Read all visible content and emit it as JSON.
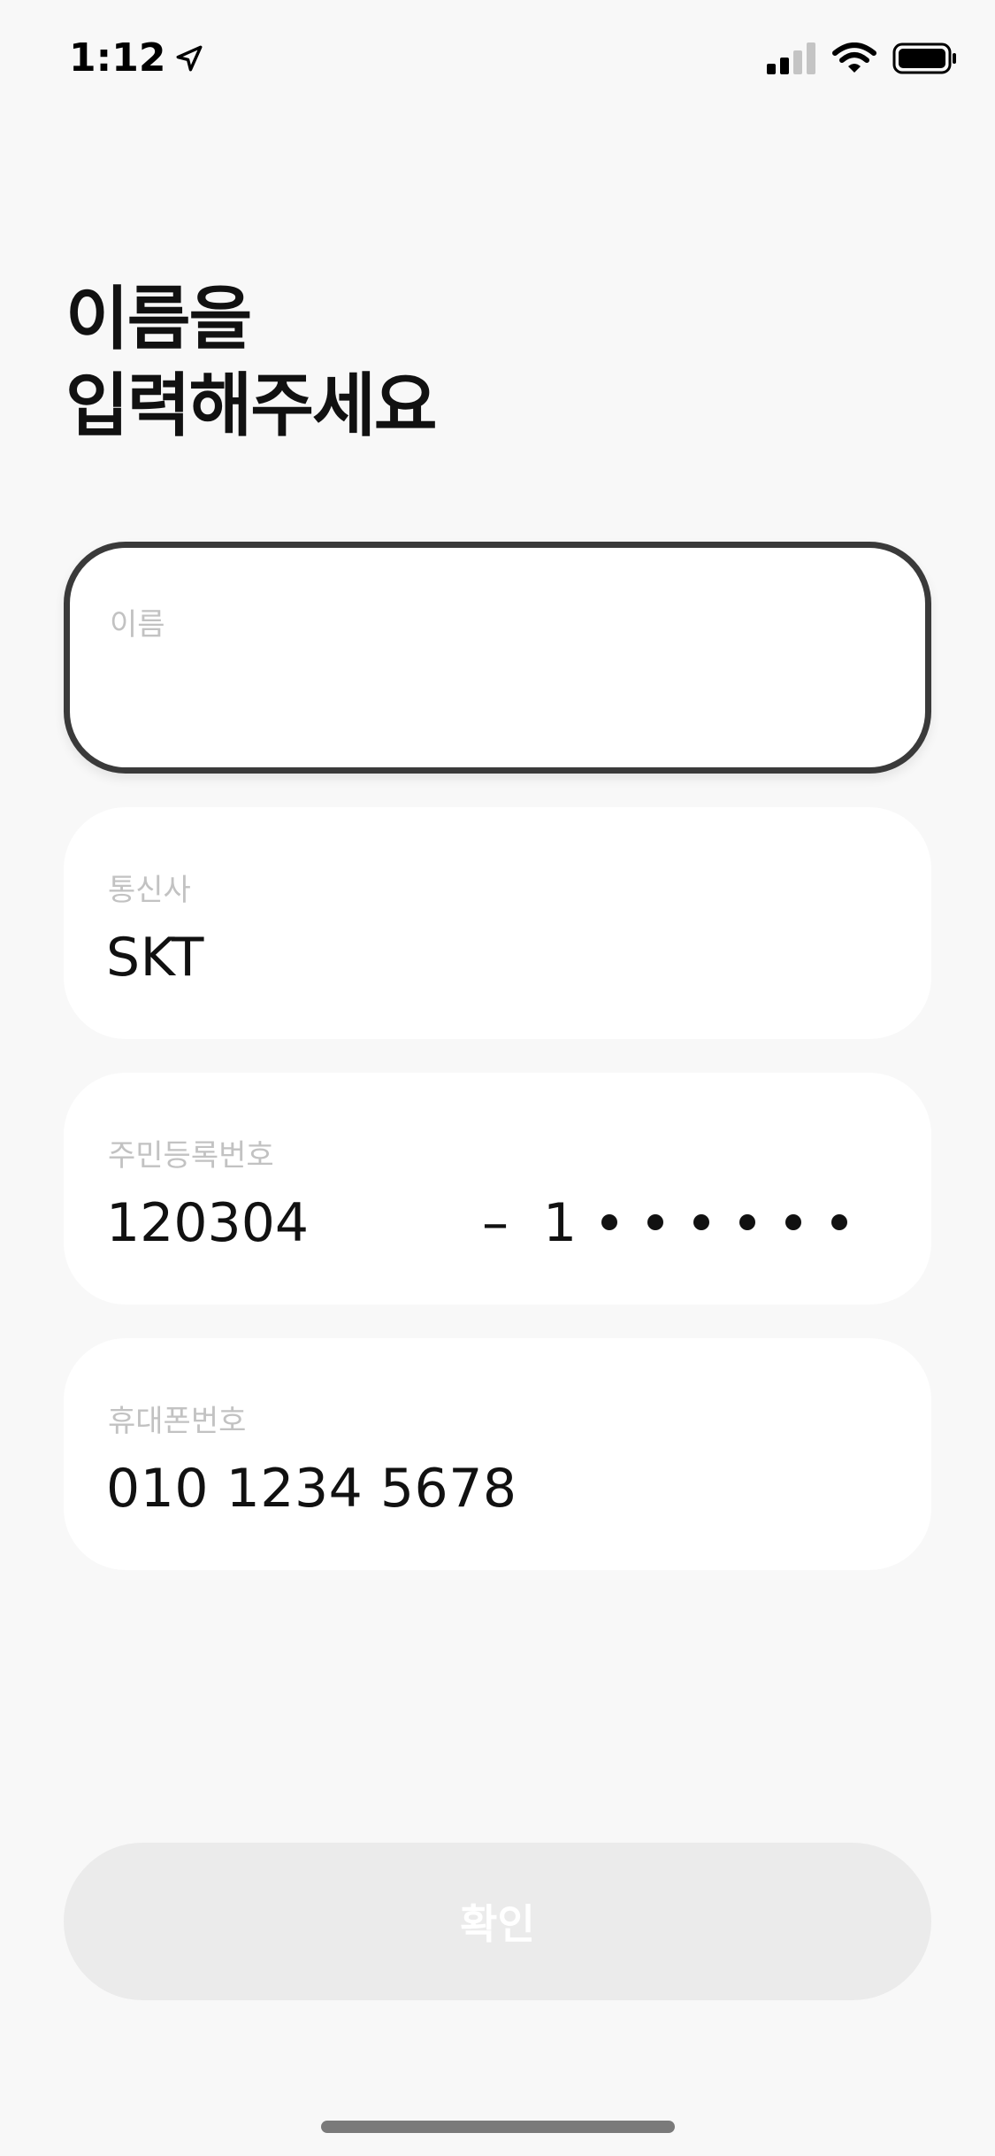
{
  "status_bar": {
    "time": "1:12",
    "icons": [
      "location-arrow-icon",
      "cellular-signal-icon",
      "wifi-icon",
      "battery-icon"
    ]
  },
  "title": {
    "line1": "이름을",
    "line2": "입력해주세요"
  },
  "fields": {
    "name": {
      "label": "이름",
      "value": ""
    },
    "carrier": {
      "label": "통신사",
      "value": "SKT"
    },
    "resident_number": {
      "label": "주민등록번호",
      "front": "120304",
      "separator": "–",
      "back_first_digit": "1",
      "masked_digits": 6
    },
    "phone": {
      "label": "휴대폰번호",
      "value": "010 1234 5678"
    }
  },
  "confirm_button": {
    "label": "확인",
    "state": "disabled"
  },
  "colors": {
    "background": "#f8f8f8",
    "field_background": "#ffffff",
    "active_border": "#3a3a3a",
    "label_gray": "#c2c2c2",
    "button_disabled": "#ebebeb"
  }
}
